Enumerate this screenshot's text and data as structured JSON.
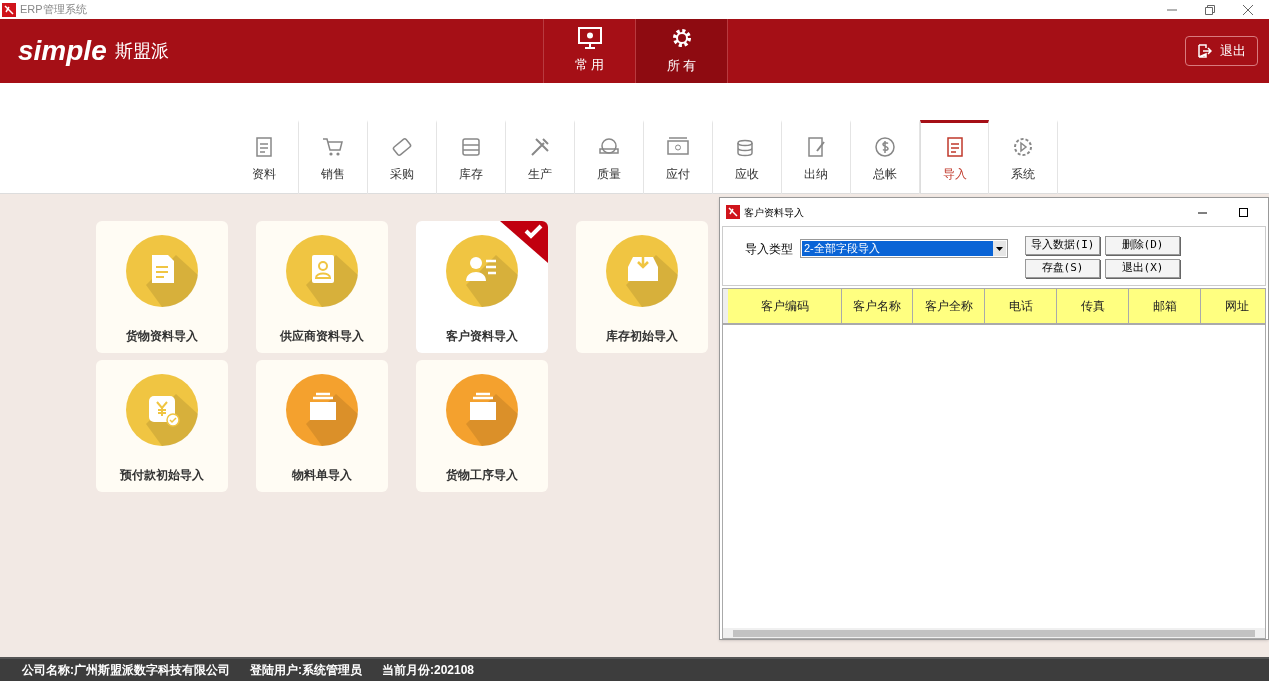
{
  "window": {
    "title": "ERP管理系统"
  },
  "header": {
    "logo": "simple",
    "brand": "斯盟派",
    "nav": [
      {
        "label": "常 用",
        "kind": "monitor",
        "selected": false
      },
      {
        "label": "所 有",
        "kind": "gear",
        "selected": true
      }
    ],
    "exit_button": "退出"
  },
  "modules": [
    {
      "label": "资料",
      "kind": "doc",
      "selected": false
    },
    {
      "label": "销售",
      "kind": "cart",
      "selected": false
    },
    {
      "label": "采购",
      "kind": "card",
      "selected": false
    },
    {
      "label": "库存",
      "kind": "tray",
      "selected": false
    },
    {
      "label": "生产",
      "kind": "tools",
      "selected": false
    },
    {
      "label": "质量",
      "kind": "badge",
      "selected": false
    },
    {
      "label": "应付",
      "kind": "bill",
      "selected": false
    },
    {
      "label": "应收",
      "kind": "coins",
      "selected": false
    },
    {
      "label": "出纳",
      "kind": "note",
      "selected": false
    },
    {
      "label": "总帐",
      "kind": "dollar",
      "selected": false
    },
    {
      "label": "导入",
      "kind": "doc",
      "selected": true
    },
    {
      "label": "系统",
      "kind": "gear",
      "selected": false
    }
  ],
  "cards": [
    {
      "label": "货物资料导入",
      "kind": "doc",
      "color": "#f0c542",
      "selected": false
    },
    {
      "label": "供应商资料导入",
      "kind": "contact",
      "color": "#f0c542",
      "selected": false
    },
    {
      "label": "客户资料导入",
      "kind": "person",
      "color": "#f0c542",
      "selected": true
    },
    {
      "label": "库存初始导入",
      "kind": "inbox",
      "color": "#f0c542",
      "selected": false
    },
    {
      "label": "预付款初始导入",
      "kind": "yen",
      "color": "#f0c542",
      "selected": false
    },
    {
      "label": "物料单导入",
      "kind": "stack",
      "color": "#f4a12e",
      "selected": false
    },
    {
      "label": "货物工序导入",
      "kind": "stack",
      "color": "#f4a12e",
      "selected": false
    }
  ],
  "dialog": {
    "title": "客户资料导入",
    "import_type_label": "导入类型",
    "import_type_value": "2-全部字段导入",
    "buttons": [
      "导入数据(I)",
      "删除(D)",
      "存盘(S)",
      "退出(X)"
    ],
    "columns": [
      "客户编码",
      "客户名称",
      "客户全称",
      "电话",
      "传真",
      "邮箱",
      "网址"
    ]
  },
  "status_bar": [
    "公司名称:广州斯盟派数字科技有限公司",
    "登陆用户:系统管理员",
    "当前月份:202108"
  ]
}
